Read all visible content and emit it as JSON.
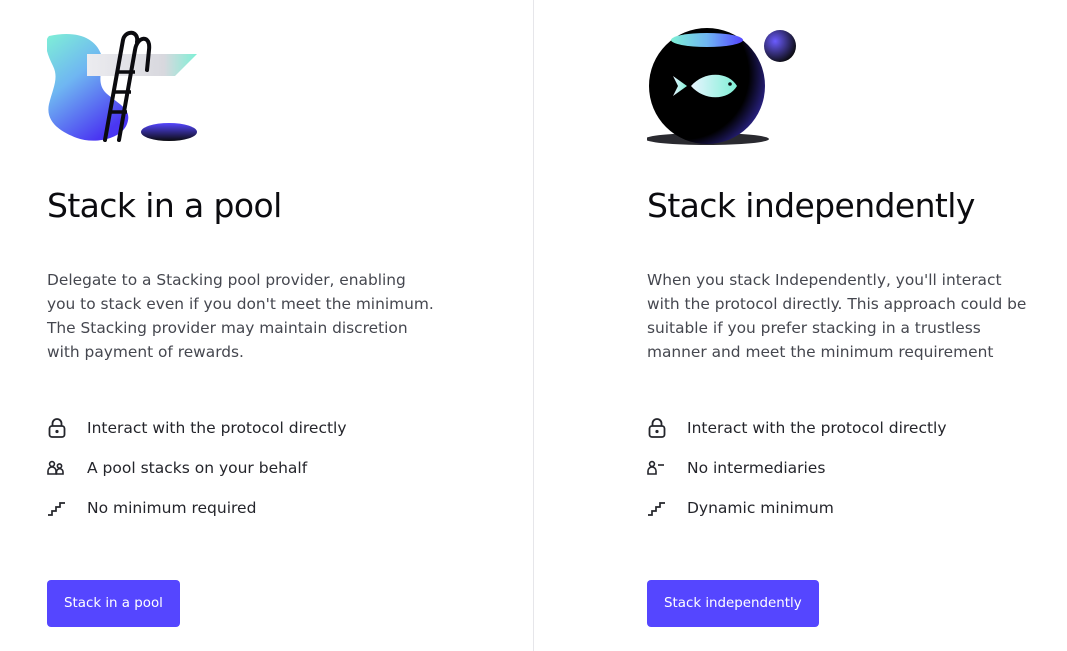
{
  "pool": {
    "title": "Stack in a pool",
    "description": "Delegate to a Stacking pool provider, enabling you to stack even if you don't meet the minimum. The Stacking provider may maintain discretion with payment of rewards.",
    "features": [
      {
        "icon": "lock-icon",
        "label": "Interact with the protocol directly"
      },
      {
        "icon": "users-icon",
        "label": "A pool stacks on your behalf"
      },
      {
        "icon": "stairs-icon",
        "label": "No minimum required"
      }
    ],
    "button_label": "Stack in a pool"
  },
  "independent": {
    "title": "Stack independently",
    "description": "When you stack Independently, you'll interact with the protocol directly. This approach could be suitable if you prefer stacking in a trustless manner and meet the minimum requirement",
    "features": [
      {
        "icon": "lock-icon",
        "label": "Interact with the protocol directly"
      },
      {
        "icon": "person-minus-icon",
        "label": "No intermediaries"
      },
      {
        "icon": "stairs-icon",
        "label": "Dynamic minimum"
      }
    ],
    "button_label": "Stack independently"
  },
  "colors": {
    "accent": "#5546ff",
    "title": "#0b0b0f",
    "body_text": "#45474f",
    "divider": "#e6e6ea"
  }
}
